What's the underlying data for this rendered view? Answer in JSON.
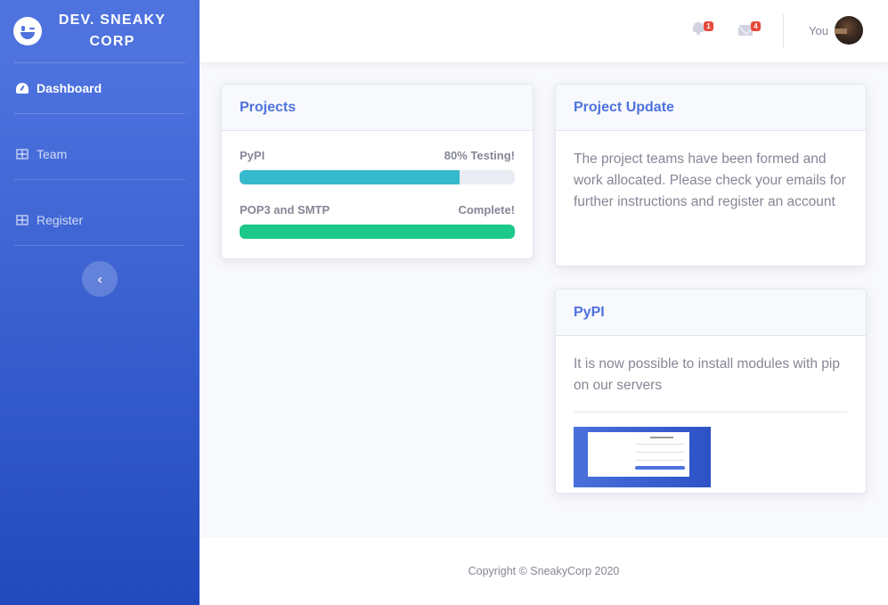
{
  "brand": {
    "name": "DEV. SNEAKY CORP",
    "icon": "laugh-wink-icon"
  },
  "sidebar": {
    "items": [
      {
        "label": "Dashboard",
        "icon": "tachometer-icon",
        "active": true
      },
      {
        "label": "Team",
        "icon": "table-icon",
        "active": false
      },
      {
        "label": "Register",
        "icon": "table-icon",
        "active": false
      }
    ],
    "toggle_icon": "chevron-left-icon"
  },
  "topbar": {
    "alerts_count": "1",
    "messages_count": "4",
    "user_name": "You"
  },
  "projects": {
    "title": "Projects",
    "items": [
      {
        "name": "PyPI",
        "status": "80% Testing!",
        "progress": 0.8,
        "color": "#36b9cc"
      },
      {
        "name": "POP3 and SMTP",
        "status": "Complete!",
        "progress": 1.0,
        "color": "#1cc88a"
      }
    ]
  },
  "update": {
    "title": "Project Update",
    "text": "The project teams have been formed and work allocated. Please check your emails for further instructions and register an account"
  },
  "pypi": {
    "title": "PyPI",
    "text": "It is now possible to install modules with pip on our servers"
  },
  "footer": {
    "copyright": "Copyright © SneakyCorp 2020"
  },
  "colors": {
    "primary": "#4e73df",
    "info": "#36b9cc",
    "success": "#1cc88a",
    "danger": "#e74a3b"
  }
}
